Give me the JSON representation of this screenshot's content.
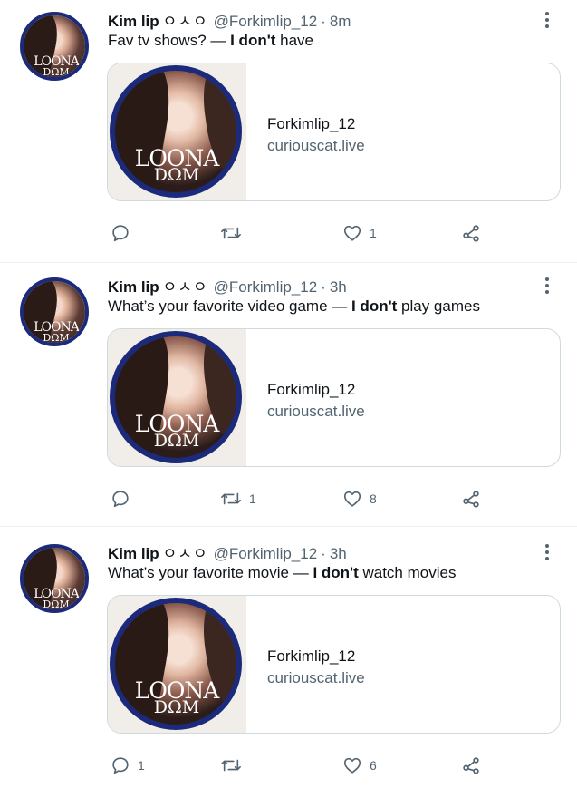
{
  "tweets": [
    {
      "author": {
        "name": "Kim lip",
        "name_korean": "ㅇㅅㅇ",
        "handle": "@Forkimlip_12"
      },
      "time": "8m",
      "text_prefix": "Fav tv shows? — ",
      "text_bold": "I don't",
      "text_suffix": " have",
      "card": {
        "title": "Forkimlip_12",
        "domain": "curiouscat.live"
      },
      "counts": {
        "reply": "",
        "retweet": "",
        "like": "1"
      }
    },
    {
      "author": {
        "name": "Kim lip",
        "name_korean": "ㅇㅅㅇ",
        "handle": "@Forkimlip_12"
      },
      "time": "3h",
      "text_prefix": "What’s your favorite video game — ",
      "text_bold": "I don't",
      "text_suffix": " play games",
      "card": {
        "title": "Forkimlip_12",
        "domain": "curiouscat.live"
      },
      "counts": {
        "reply": "",
        "retweet": "1",
        "like": "8"
      }
    },
    {
      "author": {
        "name": "Kim lip",
        "name_korean": "ㅇㅅㅇ",
        "handle": "@Forkimlip_12"
      },
      "time": "3h",
      "text_prefix": "What’s your favorite movie — ",
      "text_bold": "I don't",
      "text_suffix": " watch movies",
      "card": {
        "title": "Forkimlip_12",
        "domain": "curiouscat.live"
      },
      "counts": {
        "reply": "1",
        "retweet": "",
        "like": "6"
      }
    }
  ],
  "avatar_logo": {
    "line1": "LOONA",
    "line2": "DΩM"
  },
  "dot": "·",
  "icons": {
    "more": "more-vertical-icon",
    "reply": "reply-icon",
    "retweet": "retweet-icon",
    "like": "heart-icon",
    "share": "share-icon"
  },
  "colors": {
    "text": "#0f1419",
    "secondary": "#536471",
    "border": "#cfd9de",
    "ring": "#1b2a7a"
  }
}
